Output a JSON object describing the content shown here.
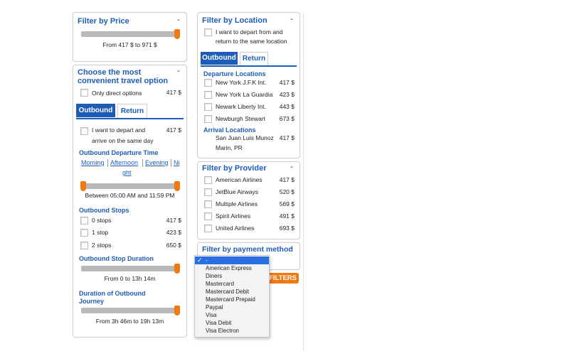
{
  "price_filter": {
    "title": "Filter by Price",
    "range_text": "From 417 $ to 971 $",
    "range_fraction": [
      0.0,
      1.0
    ]
  },
  "travel_option": {
    "title_line1": "Choose the most",
    "title_line2": "convenient travel option",
    "direct_label": "Only direct options",
    "direct_price": "417 $",
    "tabs": [
      "Outbound",
      "Return"
    ],
    "same_day_line1": "I want to depart and",
    "same_day_line2": "arrive on the same day",
    "same_day_price": "417 $",
    "departure_time_title": "Outbound Departure Time",
    "time_links": [
      "Morning",
      "Afternoon",
      "Evening",
      "Ni",
      "ght"
    ],
    "departure_range_text": "Between 05:00 AM and 11:59 PM",
    "stops_title": "Outbound Stops",
    "stops": [
      {
        "label": "0 stops",
        "price": "417 $"
      },
      {
        "label": "1 stop",
        "price": "423 $"
      },
      {
        "label": "2 stops",
        "price": "650 $"
      }
    ],
    "stop_duration_title": "Outbound Stop Duration",
    "stop_duration_text": "From 0 to 13h 14m",
    "journey_title_line1": "Duration of Outbound",
    "journey_title_line2": "Journey",
    "journey_text": "From 3h 46m to 19h 13m"
  },
  "location_filter": {
    "title": "Filter by Location",
    "same_location_line1": "I want to depart from and",
    "same_location_line2": "return to the same location",
    "tabs": [
      "Outbound",
      "Return"
    ],
    "departure_title": "Departure Locations",
    "departures": [
      {
        "label": "New York J.F.K Int.",
        "price": "417 $"
      },
      {
        "label": "New York La Guardia",
        "price": "423 $"
      },
      {
        "label": "Newark Liberty Int.",
        "price": "443 $"
      },
      {
        "label": "Newburgh Stewart",
        "price": "673 $"
      }
    ],
    "arrival_title": "Arrival Locations",
    "arrival_line1": "San Juan Luis Munoz",
    "arrival_line2": "Marin, PR",
    "arrival_price": "417 $"
  },
  "provider_filter": {
    "title": "Filter by Provider",
    "providers": [
      {
        "label": "American Airlines",
        "price": "417 $"
      },
      {
        "label": "JetBlue Airways",
        "price": "520 $"
      },
      {
        "label": "Multiple Airlines",
        "price": "569 $"
      },
      {
        "label": "Spirit Airlines",
        "price": "491 $"
      },
      {
        "label": "United Airlines",
        "price": "693 $"
      }
    ]
  },
  "payment_filter": {
    "title": "Filter by payment method",
    "selected": "-",
    "options": [
      "-",
      "American Express",
      "Diners",
      "Mastercard",
      "Mastercard Debit",
      "Mastercard Prepaid",
      "Paypal",
      "Visa",
      "Visa Debit",
      "Visa Electron"
    ],
    "filters_button": "FILTERS"
  },
  "colors": {
    "accent": "#1d5db8",
    "slider_knob": "#f07a10",
    "dropdown_highlight": "#2a6fe0"
  }
}
